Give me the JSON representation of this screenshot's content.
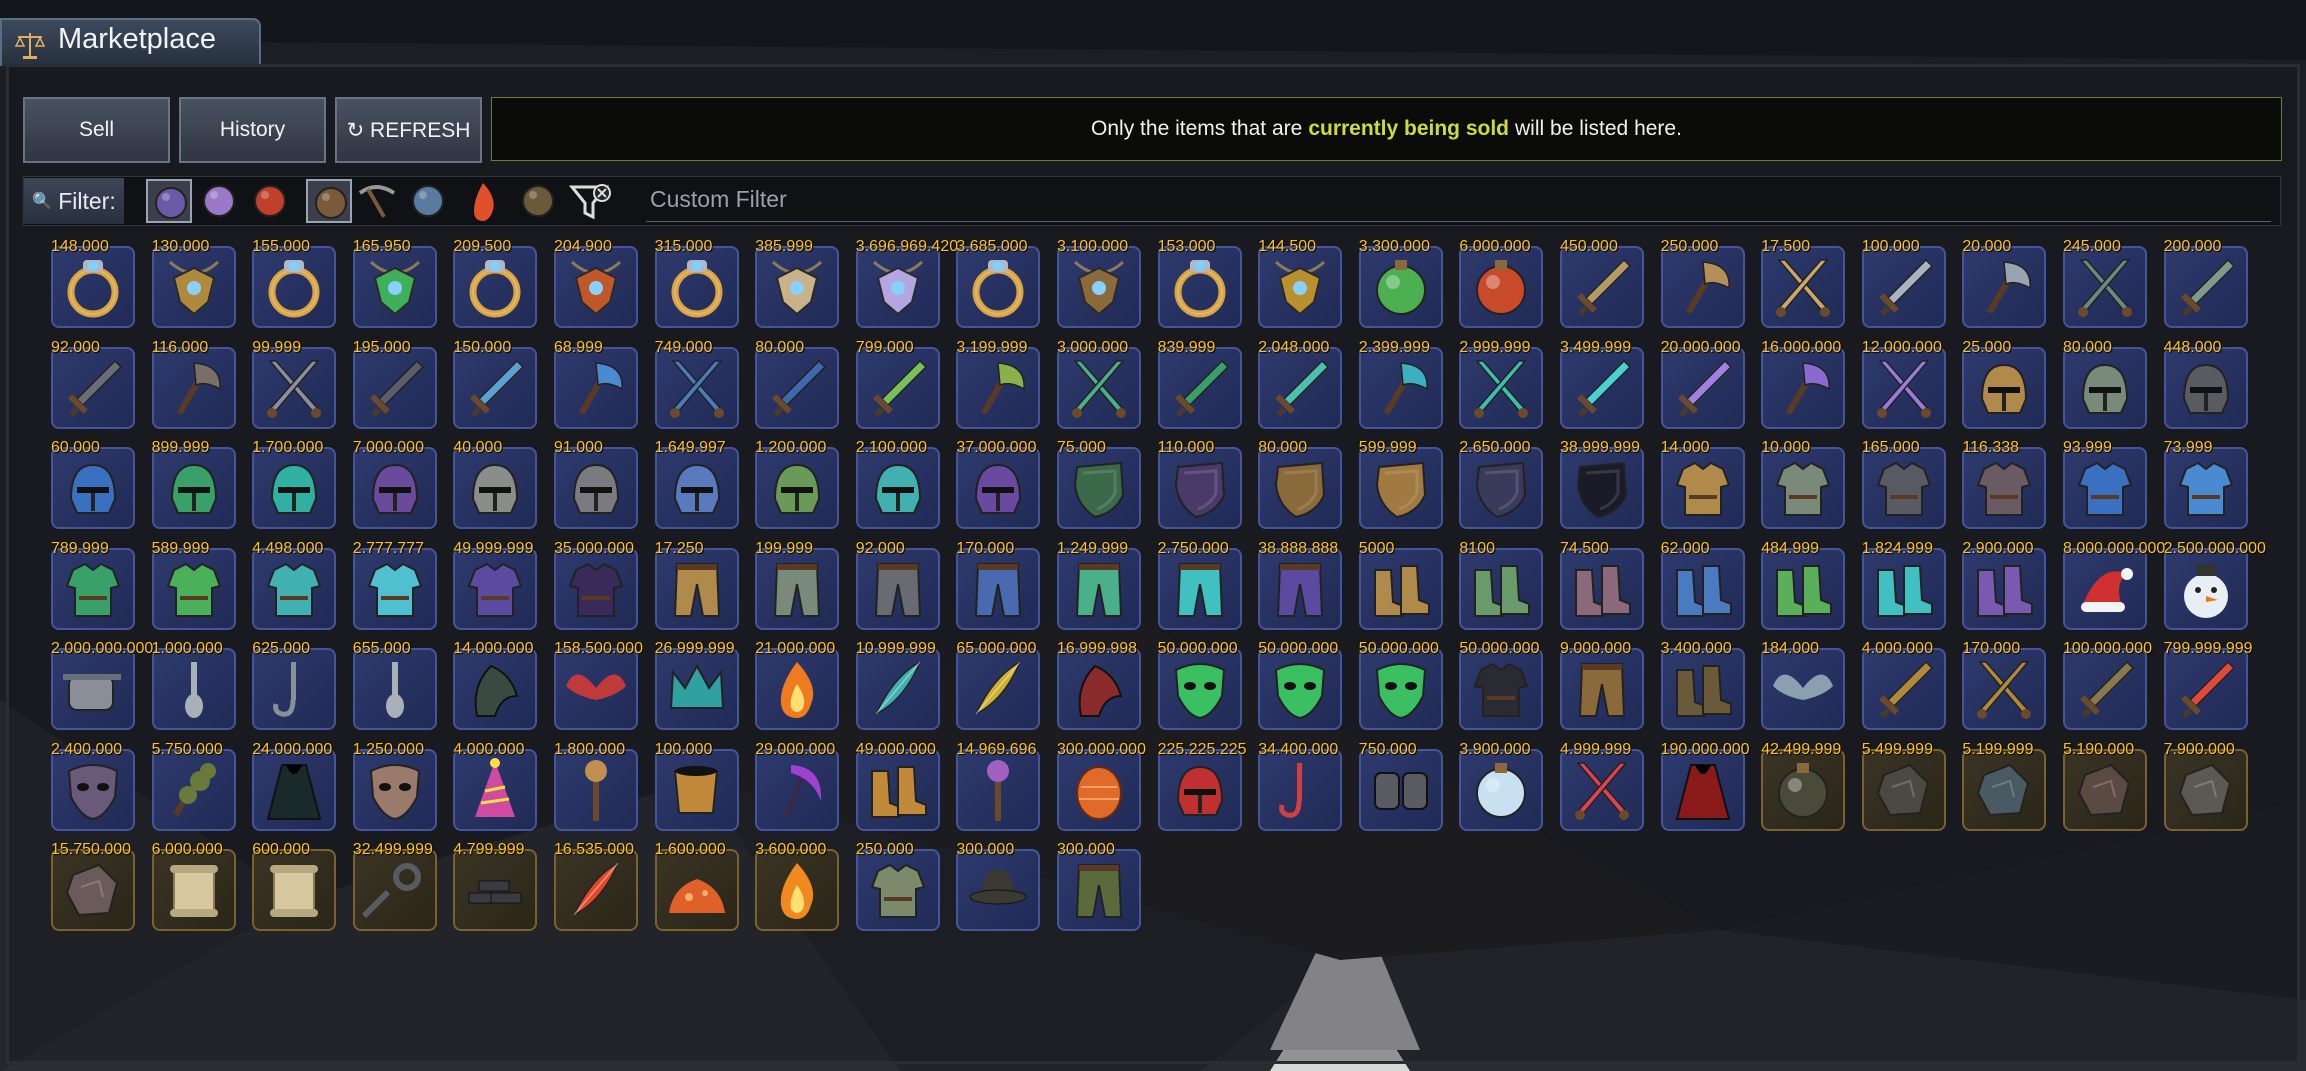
{
  "title": "Marketplace",
  "buttons": {
    "sell": "Sell",
    "history": "History",
    "refresh": "↻ REFRESH"
  },
  "info": {
    "pre": "Only the items that are",
    "highlight": "currently being sold",
    "post": "will be listed here."
  },
  "filter": {
    "label": "Filter:",
    "placeholder": "Custom Filter",
    "icons": [
      "armor-filter-icon",
      "mineral-filter-icon",
      "cauldron-filter-icon",
      "orb-filter-icon",
      "pickaxe-filter-icon",
      "crafting-filter-icon",
      "fire-filter-icon",
      "book-filter-icon",
      "clear-filter-icon"
    ]
  },
  "items": [
    {
      "price": "148.000",
      "icon": "ring",
      "color": "#d9a441",
      "slot": "blue"
    },
    {
      "price": "130.000",
      "icon": "amulet",
      "color": "#b08a3c",
      "slot": "blue"
    },
    {
      "price": "155.000",
      "icon": "ring",
      "color": "#d9a441",
      "slot": "blue"
    },
    {
      "price": "165.950",
      "icon": "amulet",
      "color": "#3faf5a",
      "slot": "blue"
    },
    {
      "price": "209.500",
      "icon": "ring",
      "color": "#d9a441",
      "slot": "blue"
    },
    {
      "price": "204.900",
      "icon": "amulet",
      "color": "#c0582a",
      "slot": "blue"
    },
    {
      "price": "315.000",
      "icon": "ring",
      "color": "#d9a441",
      "slot": "blue"
    },
    {
      "price": "385.999",
      "icon": "amulet",
      "color": "#c9b28a",
      "slot": "blue"
    },
    {
      "price": "3.696.969.420",
      "icon": "amulet",
      "color": "#b4a6e0",
      "slot": "blue"
    },
    {
      "price": "3.685.000",
      "icon": "ring",
      "color": "#d9a441",
      "slot": "blue"
    },
    {
      "price": "3.100.000",
      "icon": "amulet",
      "color": "#8a6a3a",
      "slot": "blue"
    },
    {
      "price": "153.000",
      "icon": "ring",
      "color": "#d9a441",
      "slot": "blue"
    },
    {
      "price": "144.500",
      "icon": "amulet",
      "color": "#b8902e",
      "slot": "blue"
    },
    {
      "price": "3.300.000",
      "icon": "orb",
      "color": "#4caf50",
      "slot": "blue"
    },
    {
      "price": "6.000.000",
      "icon": "orb",
      "color": "#c84a2a",
      "slot": "blue"
    },
    {
      "price": "450.000",
      "icon": "sword",
      "color": "#b59a64",
      "slot": "blue"
    },
    {
      "price": "250.000",
      "icon": "axe",
      "color": "#b58f5a",
      "slot": "blue"
    },
    {
      "price": "17.500",
      "icon": "swords",
      "color": "#c9a86a",
      "slot": "blue"
    },
    {
      "price": "100.000",
      "icon": "sword",
      "color": "#aab4c0",
      "slot": "blue"
    },
    {
      "price": "20.000",
      "icon": "axe",
      "color": "#9aa4b0",
      "slot": "blue"
    },
    {
      "price": "245.000",
      "icon": "swords",
      "color": "#6a8a80",
      "slot": "blue"
    },
    {
      "price": "200.000",
      "icon": "sword",
      "color": "#7f9a8a",
      "slot": "blue"
    },
    {
      "price": "92.000",
      "icon": "sword",
      "color": "#6a6e78",
      "slot": "blue"
    },
    {
      "price": "116.000",
      "icon": "axe",
      "color": "#7a6e68",
      "slot": "blue"
    },
    {
      "price": "99.999",
      "icon": "swords",
      "color": "#8a8ea0",
      "slot": "blue"
    },
    {
      "price": "195.000",
      "icon": "sword",
      "color": "#5a5e6a",
      "slot": "blue"
    },
    {
      "price": "150.000",
      "icon": "sword",
      "color": "#5aa0d0",
      "slot": "blue"
    },
    {
      "price": "68.999",
      "icon": "axe",
      "color": "#4a8ad0",
      "slot": "blue"
    },
    {
      "price": "749.000",
      "icon": "swords",
      "color": "#4a7ac0",
      "slot": "blue"
    },
    {
      "price": "80.000",
      "icon": "sword",
      "color": "#3a6ab0",
      "slot": "blue"
    },
    {
      "price": "799.000",
      "icon": "sword",
      "color": "#7ac05a",
      "slot": "blue"
    },
    {
      "price": "3.199.999",
      "icon": "axe",
      "color": "#8ab04a",
      "slot": "blue"
    },
    {
      "price": "3.000.000",
      "icon": "swords",
      "color": "#4ab08a",
      "slot": "blue"
    },
    {
      "price": "839.999",
      "icon": "sword",
      "color": "#3aa06a",
      "slot": "blue"
    },
    {
      "price": "2.048.000",
      "icon": "sword",
      "color": "#4ac0b0",
      "slot": "blue"
    },
    {
      "price": "2.399.999",
      "icon": "axe",
      "color": "#3ab0c0",
      "slot": "blue"
    },
    {
      "price": "2.999.999",
      "icon": "swords",
      "color": "#3ac0b0",
      "slot": "blue"
    },
    {
      "price": "3.499.999",
      "icon": "sword",
      "color": "#4ad0d0",
      "slot": "blue"
    },
    {
      "price": "20.000.000",
      "icon": "sword",
      "color": "#a080e0",
      "slot": "blue"
    },
    {
      "price": "16.000.000",
      "icon": "axe",
      "color": "#8a6ad0",
      "slot": "blue"
    },
    {
      "price": "12.000.000",
      "icon": "swords",
      "color": "#9a7ae0",
      "slot": "blue"
    },
    {
      "price": "25.000",
      "icon": "helmet",
      "color": "#b08a4a",
      "slot": "blue"
    },
    {
      "price": "80.000",
      "icon": "helmet",
      "color": "#7a8a7a",
      "slot": "blue"
    },
    {
      "price": "448.000",
      "icon": "helmet",
      "color": "#5a5a62",
      "slot": "blue"
    },
    {
      "price": "60.000",
      "icon": "helmet",
      "color": "#3a70c0",
      "slot": "blue"
    },
    {
      "price": "899.999",
      "icon": "helmet",
      "color": "#3aa06a",
      "slot": "blue"
    },
    {
      "price": "1.700.000",
      "icon": "helmet",
      "color": "#30b0a0",
      "slot": "blue"
    },
    {
      "price": "7.000.000",
      "icon": "helmet",
      "color": "#6a4a9a",
      "slot": "blue"
    },
    {
      "price": "40.000",
      "icon": "helmet",
      "color": "#8a8e8a",
      "slot": "blue"
    },
    {
      "price": "91.000",
      "icon": "helmet",
      "color": "#7a7a80",
      "slot": "blue"
    },
    {
      "price": "1.649.997",
      "icon": "helmet",
      "color": "#5a7ac0",
      "slot": "blue"
    },
    {
      "price": "1.200.000",
      "icon": "helmet",
      "color": "#6a9a5a",
      "slot": "blue"
    },
    {
      "price": "2.100.000",
      "icon": "helmet",
      "color": "#40b0b0",
      "slot": "blue"
    },
    {
      "price": "37.000.000",
      "icon": "helmet",
      "color": "#6a4aa0",
      "slot": "blue"
    },
    {
      "price": "75.000",
      "icon": "shield",
      "color": "#3a6a4a",
      "slot": "blue"
    },
    {
      "price": "110.000",
      "icon": "shield",
      "color": "#4a3a6a",
      "slot": "blue"
    },
    {
      "price": "80.000",
      "icon": "shield",
      "color": "#8a6a3a",
      "slot": "blue"
    },
    {
      "price": "599.999",
      "icon": "shield",
      "color": "#a07a40",
      "slot": "blue"
    },
    {
      "price": "2.650.000",
      "icon": "shield",
      "color": "#3a3a5a",
      "slot": "blue"
    },
    {
      "price": "38.999.999",
      "icon": "shield",
      "color": "#1a1a28",
      "slot": "blue"
    },
    {
      "price": "14.000",
      "icon": "armor",
      "color": "#b08a4a",
      "slot": "blue"
    },
    {
      "price": "10.000",
      "icon": "armor",
      "color": "#7a8a7a",
      "slot": "blue"
    },
    {
      "price": "165.000",
      "icon": "armor",
      "color": "#5a5a62",
      "slot": "blue"
    },
    {
      "price": "116.338",
      "icon": "armor",
      "color": "#6a5a62",
      "slot": "blue"
    },
    {
      "price": "93.999",
      "icon": "armor",
      "color": "#3a70c0",
      "slot": "blue"
    },
    {
      "price": "73.999",
      "icon": "armor",
      "color": "#4a8ad0",
      "slot": "blue"
    },
    {
      "price": "789.999",
      "icon": "armor",
      "color": "#3aa06a",
      "slot": "blue"
    },
    {
      "price": "589.999",
      "icon": "armor",
      "color": "#4ab05a",
      "slot": "blue"
    },
    {
      "price": "4.498.000",
      "icon": "armor",
      "color": "#40b0b0",
      "slot": "blue"
    },
    {
      "price": "2.777.777",
      "icon": "armor",
      "color": "#50c0d0",
      "slot": "blue"
    },
    {
      "price": "49.999.999",
      "icon": "armor",
      "color": "#5a4aa0",
      "slot": "blue"
    },
    {
      "price": "35.000.000",
      "icon": "armor",
      "color": "#3a2a5a",
      "slot": "blue"
    },
    {
      "price": "17.250",
      "icon": "legs",
      "color": "#b08a4a",
      "slot": "blue"
    },
    {
      "price": "199.999",
      "icon": "legs",
      "color": "#7a8a7a",
      "slot": "blue"
    },
    {
      "price": "92.000",
      "icon": "legs",
      "color": "#6a6a72",
      "slot": "blue"
    },
    {
      "price": "170.000",
      "icon": "legs",
      "color": "#4a6ab0",
      "slot": "blue"
    },
    {
      "price": "1.249.999",
      "icon": "legs",
      "color": "#4ab08a",
      "slot": "blue"
    },
    {
      "price": "2.750.000",
      "icon": "legs",
      "color": "#40c0c0",
      "slot": "blue"
    },
    {
      "price": "38.888.888",
      "icon": "legs",
      "color": "#5a4aa0",
      "slot": "blue"
    },
    {
      "price": "5000",
      "icon": "boots",
      "color": "#b08a4a",
      "slot": "blue"
    },
    {
      "price": "8100",
      "icon": "boots",
      "color": "#6a9a6a",
      "slot": "blue"
    },
    {
      "price": "74.500",
      "icon": "boots",
      "color": "#8a6a7a",
      "slot": "blue"
    },
    {
      "price": "62.000",
      "icon": "boots",
      "color": "#4a7ac0",
      "slot": "blue"
    },
    {
      "price": "484.999",
      "icon": "boots",
      "color": "#5ab05a",
      "slot": "blue"
    },
    {
      "price": "1.824.999",
      "icon": "boots",
      "color": "#40c0c0",
      "slot": "blue"
    },
    {
      "price": "2.900.000",
      "icon": "boots",
      "color": "#7a5ab0",
      "slot": "blue"
    },
    {
      "price": "8.000.000.000",
      "icon": "santa-hat",
      "color": "#d03030",
      "slot": "blue"
    },
    {
      "price": "2.500.000.000",
      "icon": "snowman",
      "color": "#e8eef4",
      "slot": "blue"
    },
    {
      "price": "2.000.000.000",
      "icon": "pot",
      "color": "#8a8e98",
      "slot": "blue"
    },
    {
      "price": "1.000.000",
      "icon": "spoon",
      "color": "#aab0b8",
      "slot": "blue"
    },
    {
      "price": "625.000",
      "icon": "hook",
      "color": "#8a9098",
      "slot": "blue"
    },
    {
      "price": "655.000",
      "icon": "spoon",
      "color": "#aab0b8",
      "slot": "blue"
    },
    {
      "price": "14.000.000",
      "icon": "claw",
      "color": "#3a4a42",
      "slot": "blue"
    },
    {
      "price": "158.500.000",
      "icon": "wings",
      "color": "#c03a3a",
      "slot": "blue"
    },
    {
      "price": "26.999.999",
      "icon": "crown",
      "color": "#30a0a0",
      "slot": "blue"
    },
    {
      "price": "21.000.000",
      "icon": "flame",
      "color": "#f07a20",
      "slot": "blue"
    },
    {
      "price": "10.999.999",
      "icon": "feather",
      "color": "#40b0b0",
      "slot": "blue"
    },
    {
      "price": "65.000.000",
      "icon": "feather",
      "color": "#d0b030",
      "slot": "blue"
    },
    {
      "price": "16.999.998",
      "icon": "claw",
      "color": "#8a2a2a",
      "slot": "blue"
    },
    {
      "price": "50.000.000",
      "icon": "mask",
      "color": "#3ac060",
      "slot": "blue"
    },
    {
      "price": "50.000.000",
      "icon": "mask",
      "color": "#3ac060",
      "slot": "blue"
    },
    {
      "price": "50.000.000",
      "icon": "mask",
      "color": "#3ac060",
      "slot": "blue"
    },
    {
      "price": "50.000.000",
      "icon": "armor",
      "color": "#2a2a32",
      "slot": "blue"
    },
    {
      "price": "9.000.000",
      "icon": "legs",
      "color": "#8a6a3a",
      "slot": "blue"
    },
    {
      "price": "3.400.000",
      "icon": "boots",
      "color": "#6a5a3a",
      "slot": "blue"
    },
    {
      "price": "184.000",
      "icon": "wings",
      "color": "#8aa0b0",
      "slot": "blue"
    },
    {
      "price": "4.000.000",
      "icon": "sword",
      "color": "#b08a3a",
      "slot": "blue"
    },
    {
      "price": "170.000",
      "icon": "swords",
      "color": "#b08a3a",
      "slot": "blue"
    },
    {
      "price": "100.000.000",
      "icon": "sword",
      "color": "#8a7a4a",
      "slot": "blue"
    },
    {
      "price": "799.999.999",
      "icon": "sword",
      "color": "#e04a3a",
      "slot": "blue"
    },
    {
      "price": "2.400.000",
      "icon": "mask",
      "color": "#6a5a7a",
      "slot": "blue"
    },
    {
      "price": "5.750.000",
      "icon": "branch",
      "color": "#6a7a3a",
      "slot": "blue"
    },
    {
      "price": "24.000.000",
      "icon": "cloak",
      "color": "#1a2a2a",
      "slot": "blue"
    },
    {
      "price": "1.250.000",
      "icon": "mask",
      "color": "#9a7a6a",
      "slot": "blue"
    },
    {
      "price": "4.000.000",
      "icon": "party-hat",
      "color": "#d04aa0",
      "slot": "blue"
    },
    {
      "price": "1.800.000",
      "icon": "staff",
      "color": "#c09050",
      "slot": "blue"
    },
    {
      "price": "100.000",
      "icon": "cup",
      "color": "#c08a3a",
      "slot": "blue"
    },
    {
      "price": "29.000.000",
      "icon": "scythe",
      "color": "#a040d0",
      "slot": "blue"
    },
    {
      "price": "49.000.000",
      "icon": "boots",
      "color": "#c08a3a",
      "slot": "blue"
    },
    {
      "price": "14.969.696",
      "icon": "staff",
      "color": "#a060c0",
      "slot": "blue"
    },
    {
      "price": "300.000.000",
      "icon": "egg",
      "color": "#e06a2a",
      "slot": "blue"
    },
    {
      "price": "225.225.225",
      "icon": "helmet",
      "color": "#c03030",
      "slot": "blue"
    },
    {
      "price": "34.400.000",
      "icon": "hook",
      "color": "#d04040",
      "slot": "blue"
    },
    {
      "price": "750.000",
      "icon": "gloves",
      "color": "#5a5a62",
      "slot": "blue"
    },
    {
      "price": "3.900.000",
      "icon": "orb",
      "color": "#c8e0f0",
      "slot": "blue"
    },
    {
      "price": "4.999.999",
      "icon": "swords",
      "color": "#e04050",
      "slot": "blue"
    },
    {
      "price": "190.000.000",
      "icon": "cloak",
      "color": "#8a1a1a",
      "slot": "blue"
    },
    {
      "price": "42.499.999",
      "icon": "orb",
      "color": "#4a4a3a",
      "slot": "gold"
    },
    {
      "price": "5.499.999",
      "icon": "shard",
      "color": "#4a4a42",
      "slot": "gold"
    },
    {
      "price": "5.199.999",
      "icon": "shard",
      "color": "#4a5a62",
      "slot": "gold"
    },
    {
      "price": "5.190.000",
      "icon": "shard",
      "color": "#5a4a42",
      "slot": "gold"
    },
    {
      "price": "7.900.000",
      "icon": "shard",
      "color": "#5a5a52",
      "slot": "gold"
    },
    {
      "price": "15.750.000",
      "icon": "shard",
      "color": "#6a5a5a",
      "slot": "gold"
    },
    {
      "price": "6.000.000",
      "icon": "scroll",
      "color": "#d8c8a0",
      "slot": "gold"
    },
    {
      "price": "600.000",
      "icon": "scroll",
      "color": "#d8c8a0",
      "slot": "gold"
    },
    {
      "price": "32.499.999",
      "icon": "key",
      "color": "#5a5a62",
      "slot": "gold"
    },
    {
      "price": "4.799.999",
      "icon": "bars",
      "color": "#3a3a42",
      "slot": "gold"
    },
    {
      "price": "16.535.000",
      "icon": "feather",
      "color": "#e04a2a",
      "slot": "gold"
    },
    {
      "price": "1.600.000",
      "icon": "pile",
      "color": "#e0602a",
      "slot": "gold"
    },
    {
      "price": "3.600.000",
      "icon": "flame",
      "color": "#f08a20",
      "slot": "gold"
    },
    {
      "price": "250.000",
      "icon": "armor",
      "color": "#7a8a6a",
      "slot": "blue"
    },
    {
      "price": "300.000",
      "icon": "hat",
      "color": "#3a3a32",
      "slot": "blue"
    },
    {
      "price": "300.000",
      "icon": "legs",
      "color": "#5a6a3a",
      "slot": "blue"
    }
  ]
}
